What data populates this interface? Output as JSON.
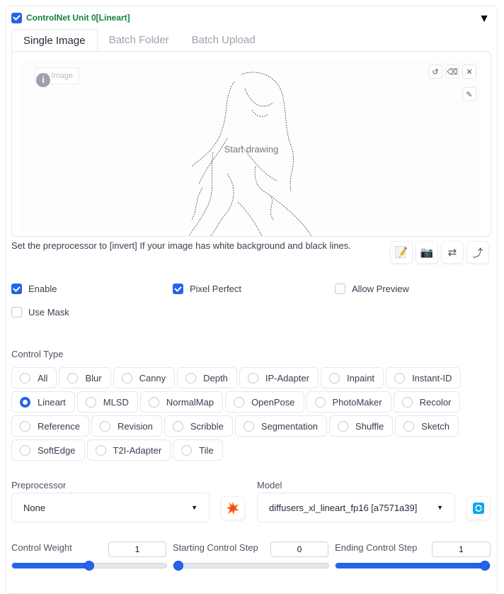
{
  "accordion": {
    "title": "ControlNet Unit 0[Lineart]",
    "enabled": true
  },
  "tabs": [
    {
      "label": "Single Image",
      "active": true
    },
    {
      "label": "Batch Folder",
      "active": false
    },
    {
      "label": "Batch Upload",
      "active": false
    }
  ],
  "canvas": {
    "image_label": "Image",
    "info_glyph": "i",
    "placeholder": "Start drawing"
  },
  "hint": "Set the preprocessor to [invert] If your image has white background and black lines.",
  "options": {
    "enable": {
      "label": "Enable",
      "checked": true
    },
    "pixel_perfect": {
      "label": "Pixel Perfect",
      "checked": true
    },
    "allow_preview": {
      "label": "Allow Preview",
      "checked": false
    },
    "use_mask": {
      "label": "Use Mask",
      "checked": false
    }
  },
  "control_type": {
    "label": "Control Type",
    "selected": "Lineart",
    "options": [
      "All",
      "Blur",
      "Canny",
      "Depth",
      "IP-Adapter",
      "Inpaint",
      "Instant-ID",
      "Lineart",
      "MLSD",
      "NormalMap",
      "OpenPose",
      "PhotoMaker",
      "Recolor",
      "Reference",
      "Revision",
      "Scribble",
      "Segmentation",
      "Shuffle",
      "Sketch",
      "SoftEdge",
      "T2I-Adapter",
      "Tile"
    ]
  },
  "preprocessor": {
    "label": "Preprocessor",
    "value": "None"
  },
  "model": {
    "label": "Model",
    "value": "diffusers_xl_lineart_fp16 [a7571a39]"
  },
  "sliders": {
    "weight": {
      "label": "Control Weight",
      "value": "1",
      "fraction": 0.5
    },
    "start": {
      "label": "Starting Control Step",
      "value": "0",
      "fraction": 0.0
    },
    "end": {
      "label": "Ending Control Step",
      "value": "1",
      "fraction": 1.0
    }
  },
  "colors": {
    "accent": "#2563eb",
    "title_green": "#15803d"
  },
  "icons": {
    "caret": "triangle-down-icon",
    "tools": [
      "edit-icon",
      "camera-icon",
      "swap-icon",
      "send-dimensions-icon"
    ],
    "preprocessor_run": "explosion-icon",
    "model_refresh": "refresh-icon"
  }
}
